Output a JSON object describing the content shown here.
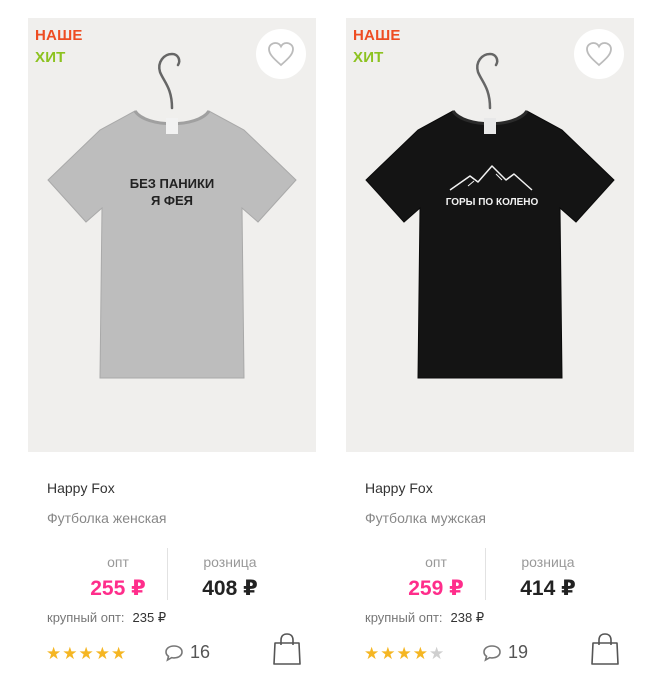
{
  "products": [
    {
      "badge_new": "НАШЕ",
      "badge_hit": "ХИТ",
      "print_line1": "БЕЗ ПАНИКИ",
      "print_line2": "Я ФЕЯ",
      "shirt_color": "#bdbdbd",
      "brand": "Happy Fox",
      "type": "Футболка женская",
      "opt_label": "опт",
      "opt_price": "255 ₽",
      "retail_label": "розница",
      "retail_price": "408 ₽",
      "bulk_label": "крупный опт:",
      "bulk_price": "235 ₽",
      "rating": 5,
      "comments": "16"
    },
    {
      "badge_new": "НАШЕ",
      "badge_hit": "ХИТ",
      "print_line1": "ГОРЫ ПО КОЛЕНО",
      "shirt_color": "#141414",
      "brand": "Happy Fox",
      "type": "Футболка мужская",
      "opt_label": "опт",
      "opt_price": "259 ₽",
      "retail_label": "розница",
      "retail_price": "414 ₽",
      "bulk_label": "крупный опт:",
      "bulk_price": "238 ₽",
      "rating": 4,
      "comments": "19"
    }
  ],
  "colors": {
    "accent_price": "#ff2d8b",
    "badge_new": "#ee4d22",
    "badge_hit": "#8cc21f",
    "star": "#f5b623"
  },
  "icons": [
    "heart-icon",
    "comment-icon",
    "shopping-bag-icon",
    "star-icon"
  ]
}
